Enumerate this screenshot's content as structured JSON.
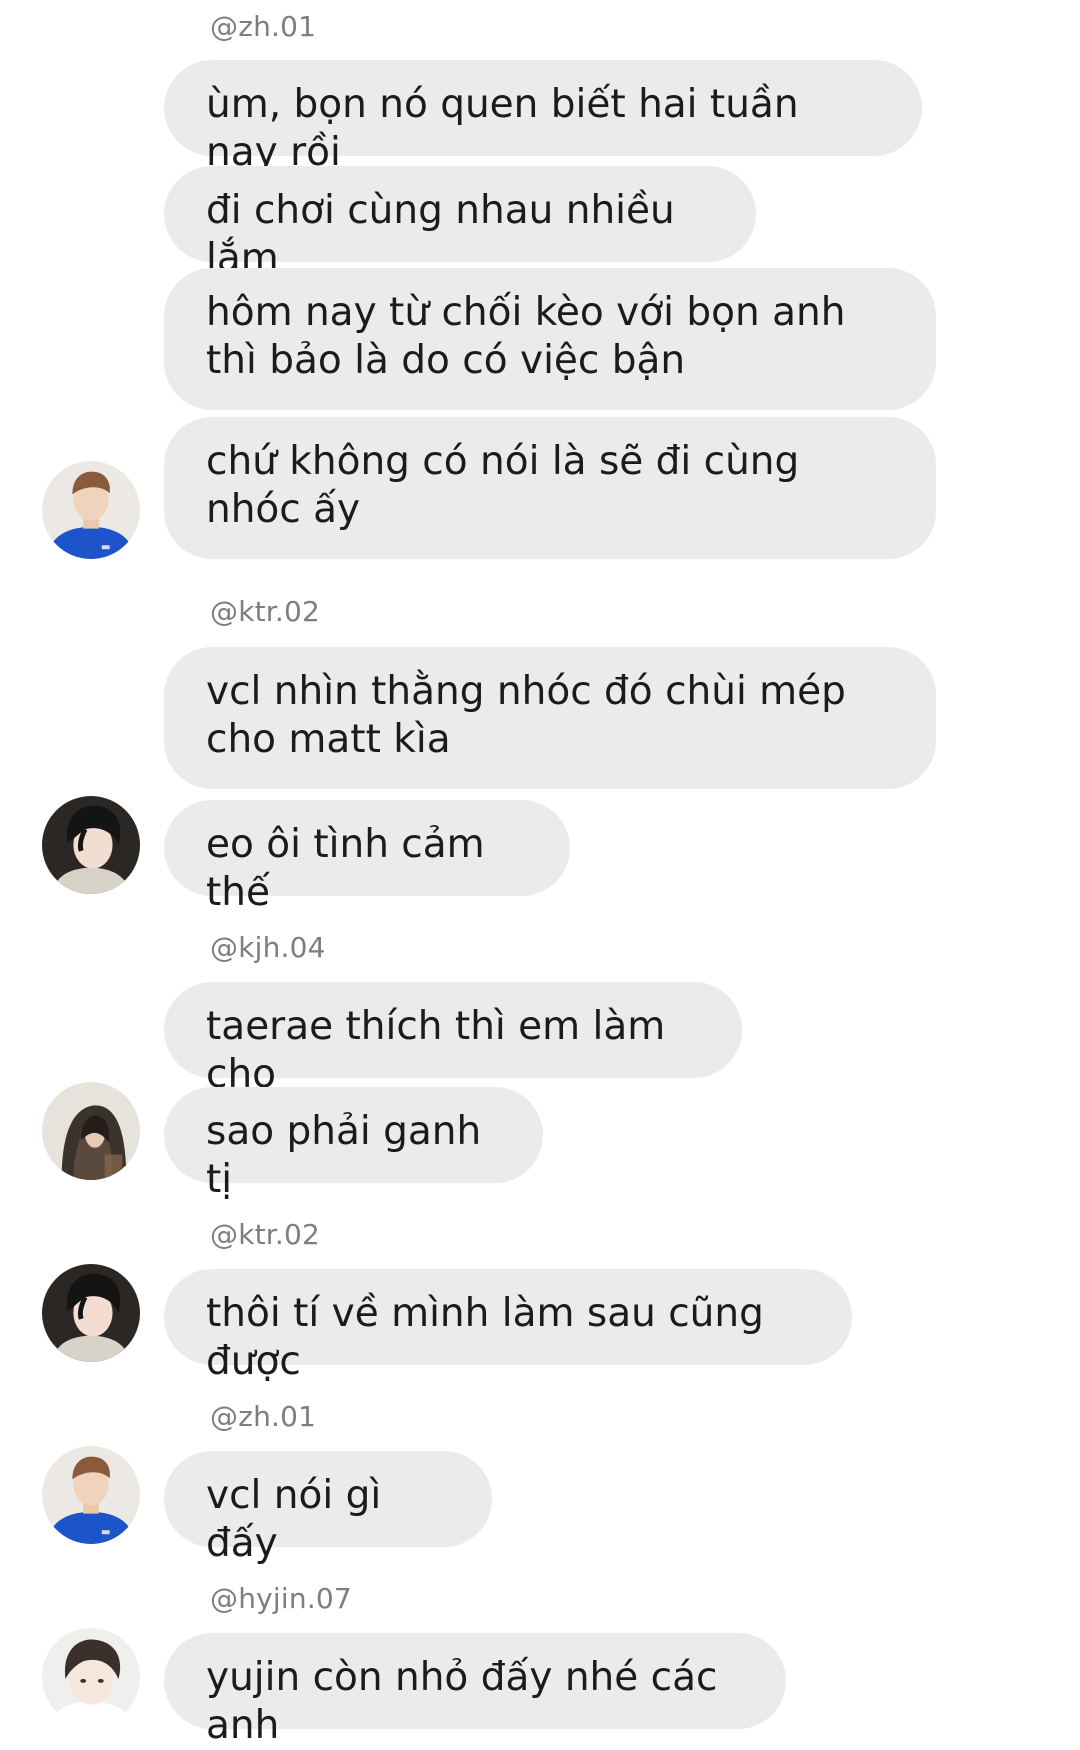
{
  "chat": {
    "groups": [
      {
        "username": "@zh.01",
        "avatar": "avatar-blue-shirt",
        "messages": [
          "ùm, bọn nó quen biết hai tuần nay rồi",
          "đi chơi cùng nhau nhiều lắm",
          "hôm nay từ chối kèo với bọn anh thì bảo là do có việc bận",
          "chứ không có nói là sẽ đi cùng nhóc ấy"
        ]
      },
      {
        "username": "@ktr.02",
        "avatar": "avatar-dark-hair",
        "messages": [
          "vcl nhìn thằng nhóc đó chùi mép cho matt kìa",
          "eo ôi tình cảm thế"
        ]
      },
      {
        "username": "@kjh.04",
        "avatar": "avatar-hooded",
        "messages": [
          "taerae thích thì em làm cho",
          "sao phải ganh tị"
        ]
      },
      {
        "username": "@ktr.02",
        "avatar": "avatar-dark-hair",
        "messages": [
          "thôi tí về mình làm sau cũng được"
        ]
      },
      {
        "username": "@zh.01",
        "avatar": "avatar-blue-shirt",
        "messages": [
          "vcl nói gì đấy"
        ]
      },
      {
        "username": "@hyjin.07",
        "avatar": "avatar-light-face",
        "messages": [
          "yujin còn nhỏ đấy nhé các anh"
        ]
      }
    ]
  },
  "colors": {
    "bubble": "#ebebeb",
    "username": "#7e7e7e",
    "text": "#1b1b1b",
    "background": "#ffffff"
  }
}
